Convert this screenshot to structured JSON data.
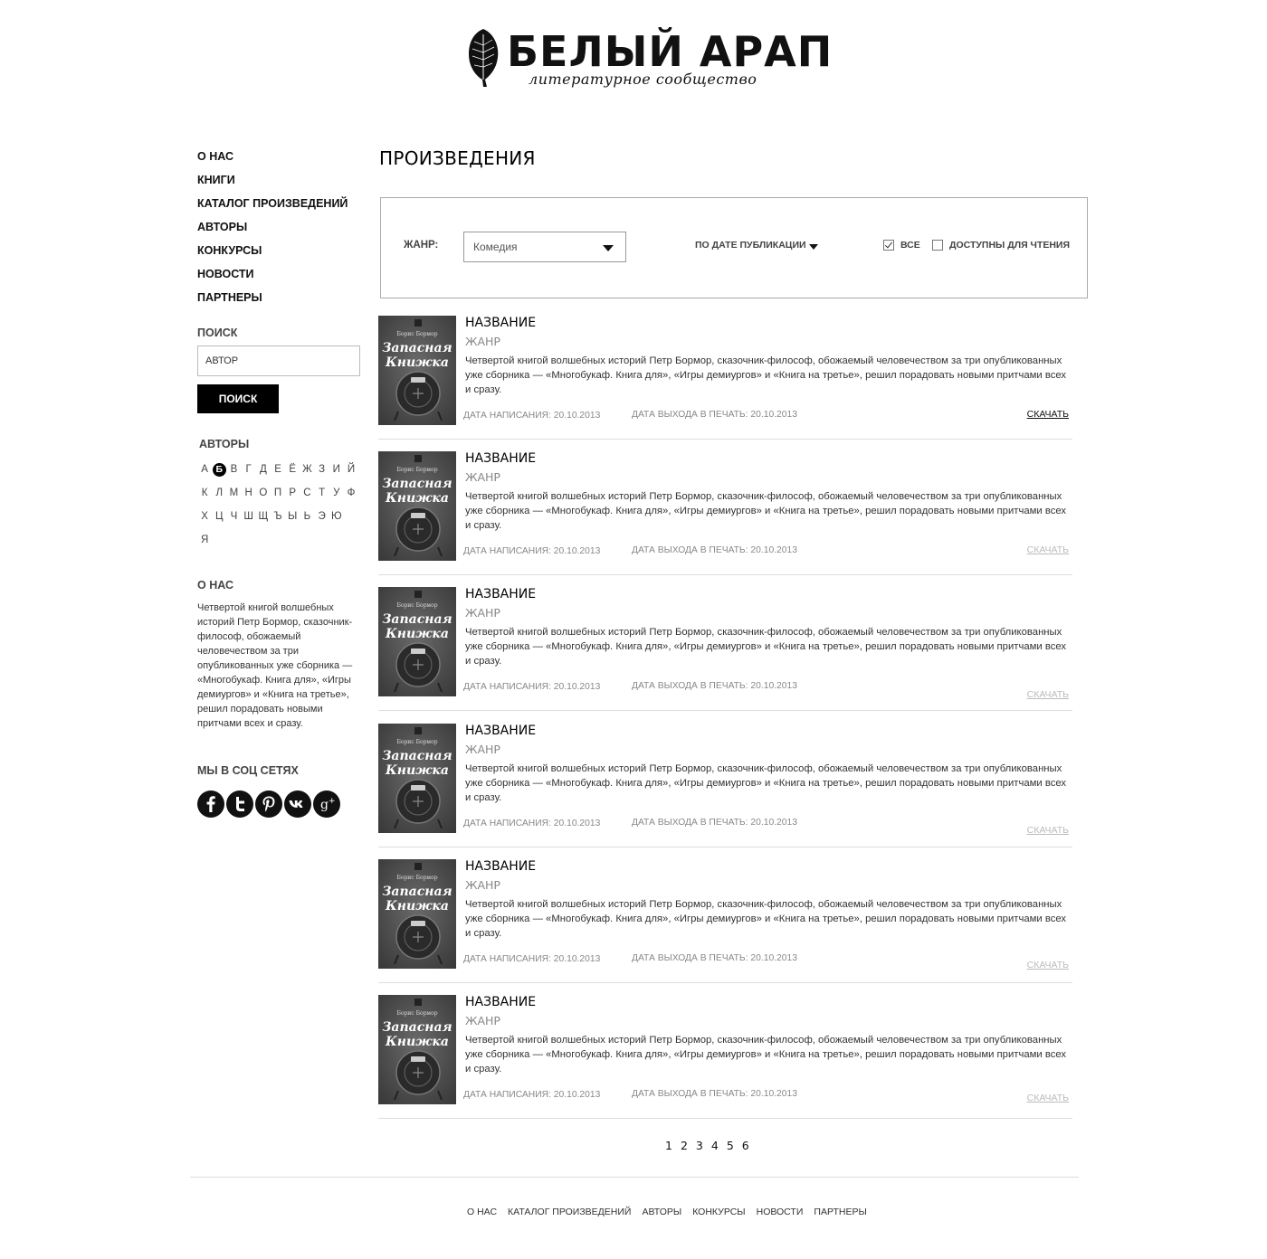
{
  "logo": {
    "title": "БЕЛЫЙ АРАП",
    "subtitle": "литературное сообщество"
  },
  "sidebar": {
    "nav": [
      {
        "label": "О НАС"
      },
      {
        "label": "КНИГИ"
      },
      {
        "label": "КАТАЛОГ ПРОИЗВЕДЕНИЙ"
      },
      {
        "label": "АВТОРЫ"
      },
      {
        "label": "КОНКУРСЫ"
      },
      {
        "label": "НОВОСТИ"
      },
      {
        "label": "ПАРТНЕРЫ"
      }
    ],
    "search_heading": "ПОИСК",
    "search_placeholder": "АВТОР",
    "search_button": "ПОИСК",
    "authors_heading": "АВТОРЫ",
    "alphabet_rows": [
      [
        "А",
        "Б",
        "В",
        "Г",
        "Д",
        "Е",
        "Ё",
        "Ж",
        "З",
        "И",
        "Й"
      ],
      [
        "К",
        "Л",
        "М",
        "Н",
        "О",
        "П",
        "Р",
        "С",
        "Т",
        "У",
        "Ф"
      ],
      [
        "Х",
        "Ц",
        "Ч",
        "Ш",
        "Щ",
        "Ъ",
        "Ы",
        "Ь",
        "Э",
        "Ю"
      ],
      [
        "Я"
      ]
    ],
    "active_letter": "Б",
    "about_heading": "О НАС",
    "about_text": "Четвертой книгой волшебных историй Петр Бормор, сказочник-философ, обожаемый человечеством за три опубликованных уже сборника — «Многобукаф. Книга для», «Игры демиургов» и «Книга на третье», решил порадовать новыми притчами всех и сразу.",
    "social_heading": "МЫ В СОЦ СЕТЯХ",
    "social": [
      {
        "icon": "facebook-icon"
      },
      {
        "icon": "twitter-icon"
      },
      {
        "icon": "pinterest-icon"
      },
      {
        "icon": "vk-icon"
      },
      {
        "icon": "google-plus-icon"
      }
    ]
  },
  "main": {
    "title": "ПРОИЗВЕДЕНИЯ",
    "filter": {
      "genre_label": "ЖАНР:",
      "genre_value": "Комедия",
      "sort_label": "ПО ДАТЕ ПУБЛИКАЦИИ",
      "all_label": "ВСЕ",
      "all_checked": true,
      "available_label": "ДОСТУПНЫ ДЛЯ ЧТЕНИЯ",
      "available_checked": false
    },
    "items": [
      {
        "title": "НАЗВАНИЕ",
        "genre": "ЖАНР",
        "description": "Четвертой книгой волшебных историй Петр Бормор, сказочник-философ, обожаемый человечеством за три опубликованных уже сборника — «Многобукаф. Книга для», «Игры демиургов» и «Книга на третье», решил порадовать новыми притчами всех и сразу.",
        "written": "ДАТА НАПИСАНИЯ: 20.10.2013",
        "printed": "ДАТА ВЫХОДА В ПЕЧАТЬ: 20.10.2013",
        "download": "СКАЧАТЬ",
        "download_active": true
      },
      {
        "title": "НАЗВАНИЕ",
        "genre": "ЖАНР",
        "description": "Четвертой книгой волшебных историй Петр Бормор, сказочник-философ, обожаемый человечеством за три опубликованных уже сборника — «Многобукаф. Книга для», «Игры демиургов» и «Книга на третье», решил порадовать новыми притчами всех и сразу.",
        "written": "ДАТА НАПИСАНИЯ: 20.10.2013",
        "printed": "ДАТА ВЫХОДА В ПЕЧАТЬ: 20.10.2013",
        "download": "СКАЧАТЬ",
        "download_active": false
      },
      {
        "title": "НАЗВАНИЕ",
        "genre": "ЖАНР",
        "description": "Четвертой книгой волшебных историй Петр Бормор, сказочник-философ, обожаемый человечеством за три опубликованных уже сборника — «Многобукаф. Книга для», «Игры демиургов» и «Книга на третье», решил порадовать новыми притчами всех и сразу.",
        "written": "ДАТА НАПИСАНИЯ: 20.10.2013",
        "printed": "ДАТА ВЫХОДА В ПЕЧАТЬ: 20.10.2013",
        "download": "СКАЧАТЬ",
        "download_active": false
      },
      {
        "title": "НАЗВАНИЕ",
        "genre": "ЖАНР",
        "description": "Четвертой книгой волшебных историй Петр Бормор, сказочник-философ, обожаемый человечеством за три опубликованных уже сборника — «Многобукаф. Книга для», «Игры демиургов» и «Книга на третье», решил порадовать новыми притчами всех и сразу.",
        "written": "ДАТА НАПИСАНИЯ: 20.10.2013",
        "printed": "ДАТА ВЫХОДА В ПЕЧАТЬ: 20.10.2013",
        "download": "СКАЧАТЬ",
        "download_active": false
      },
      {
        "title": "НАЗВАНИЕ",
        "genre": "ЖАНР",
        "description": "Четвертой книгой волшебных историй Петр Бормор, сказочник-философ, обожаемый человечеством за три опубликованных уже сборника — «Многобукаф. Книга для», «Игры демиургов» и «Книга на третье», решил порадовать новыми притчами всех и сразу.",
        "written": "ДАТА НАПИСАНИЯ: 20.10.2013",
        "printed": "ДАТА ВЫХОДА В ПЕЧАТЬ: 20.10.2013",
        "download": "СКАЧАТЬ",
        "download_active": false
      },
      {
        "title": "НАЗВАНИЕ",
        "genre": "ЖАНР",
        "description": "Четвертой книгой волшебных историй Петр Бормор, сказочник-философ, обожаемый человечеством за три опубликованных уже сборника — «Многобукаф. Книга для», «Игры демиургов» и «Книга на третье», решил порадовать новыми притчами всех и сразу.",
        "written": "ДАТА НАПИСАНИЯ: 20.10.2013",
        "printed": "ДАТА ВЫХОДА В ПЕЧАТЬ: 20.10.2013",
        "download": "СКАЧАТЬ",
        "download_active": false
      }
    ],
    "cover": {
      "top_text": "Борис Бормор",
      "title_line1": "Запасная",
      "title_line2": "Книжка"
    },
    "pagination": [
      "1",
      "2",
      "3",
      "4",
      "5",
      "6"
    ]
  },
  "footer": {
    "links": [
      "О НАС",
      "КАТАЛОГ ПРОИЗВЕДЕНИЙ",
      "АВТОРЫ",
      "КОНКУРСЫ",
      "НОВОСТИ",
      "ПАРТНЕРЫ"
    ]
  },
  "colors": {
    "text": "#111111",
    "muted": "#888888",
    "download_inactive": "#bbbbbb",
    "button_bg": "#000000"
  }
}
